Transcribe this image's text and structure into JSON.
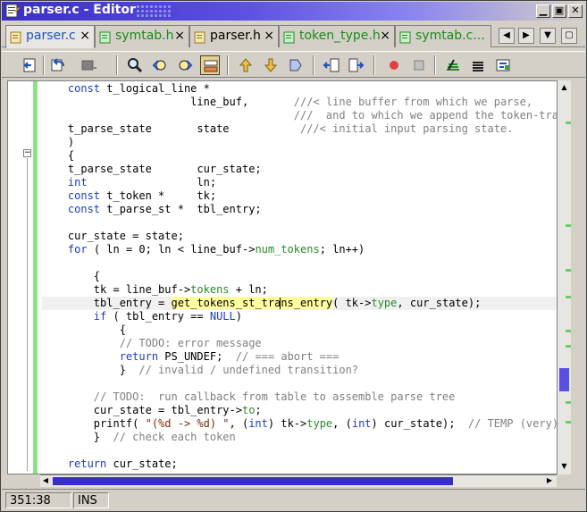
{
  "window": {
    "title": "parser.c - Editor",
    "title_icon": "editor-icon",
    "controls": [
      {
        "name": "minimize-button",
        "glyph": "▁"
      },
      {
        "name": "maximize-button",
        "glyph": "▣"
      },
      {
        "name": "close-button",
        "glyph": "✕"
      }
    ]
  },
  "tabs": [
    {
      "label": "parser.c",
      "active": true
    },
    {
      "label": "symtab.h",
      "active": false
    },
    {
      "label": "parser.h",
      "active": false
    },
    {
      "label": "token_type.h",
      "active": false
    },
    {
      "label": "symtab.c...",
      "active": false
    }
  ],
  "tab_close_glyph": "×",
  "tab_nav": [
    {
      "name": "tab-scroll-left-button",
      "glyph": "◀"
    },
    {
      "name": "tab-scroll-right-button",
      "glyph": "▶"
    },
    {
      "name": "tab-list-button",
      "glyph": "▼"
    },
    {
      "name": "tab-window-button",
      "glyph": "▢"
    }
  ],
  "toolbar": {
    "buttons": [
      "back-icon",
      "undo-icon",
      "redo-icon",
      "find-icon",
      "find-prev-icon",
      "find-next-icon",
      "highlight-icon",
      "go-up-icon",
      "go-down-icon",
      "bookmark-icon",
      "shift-left-icon",
      "shift-right-icon",
      "record-macro-icon",
      "stop-macro-icon",
      "play-macro-icon",
      "list-icon",
      "settings-icon"
    ]
  },
  "editor": {
    "lines": [
      "    const t_logical_line *",
      "                       line_buf,       ///< line buffer from which we parse,",
      "                                       ///  and to which we append the token-trac",
      "    t_parse_state       state           ///< initial input parsing state.",
      "    )",
      "    {",
      "    t_parse_state       cur_state;",
      "    int                 ln;",
      "    const t_token *     tk;",
      "    const t_parse_st *  tbl_entry;",
      "",
      "    cur_state = state;",
      "    for ( ln = 0; ln < line_buf->num_tokens; ln++)",
      "",
      "        {",
      "        tk = line_buf->tokens + ln;",
      "        tbl_entry = get_tokens_st_trans_entry( tk->type, cur_state);",
      "        if ( tbl_entry == NULL)",
      "            {",
      "            // TODO: error message",
      "            return PS_UNDEF;  // === abort ===",
      "            }  // invalid / undefined transition?",
      "",
      "        // TODO:  run callback from table to assemble parse tree",
      "        cur_state = tbl_entry->to;",
      "        printf( \"(%d -> %d) \", (int) tk->type, (int) cur_state);  // TEMP (very)",
      "        }  // check each token",
      "",
      "    return cur_state;"
    ],
    "current_line": 16,
    "scroll_up_glyph": "▲",
    "scroll_down_glyph": "▼",
    "scroll_left_glyph": "◀",
    "scroll_right_glyph": "▶"
  },
  "status": {
    "position": "351:38",
    "mode": "INS"
  },
  "colors": {
    "keyword": "#1c3cc8",
    "member": "#2a8a2a",
    "comment": "#808080",
    "string": "#7a2a00",
    "accent": "#3a2fc4",
    "gutter_changed": "#8ae28a"
  }
}
